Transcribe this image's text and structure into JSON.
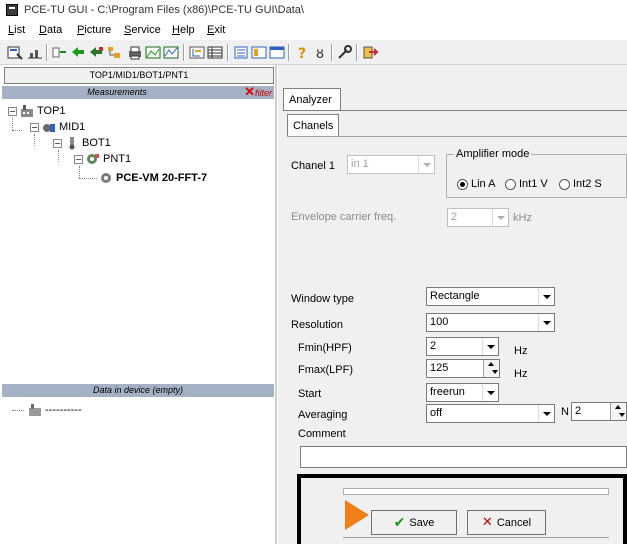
{
  "window": {
    "title": "PCE-TU GUI - C:\\Program Files (x86)\\PCE-TU GUI\\Data\\"
  },
  "menu": [
    {
      "accel": "L",
      "rest": "ist"
    },
    {
      "accel": "D",
      "rest": "ata"
    },
    {
      "accel": "P",
      "rest": "icture"
    },
    {
      "accel": "S",
      "rest": "ervice"
    },
    {
      "accel": "H",
      "rest": "elp"
    },
    {
      "accel": "E",
      "rest": "xit"
    }
  ],
  "left": {
    "path": "TOP1/MID1/BOT1/PNT1",
    "measurements_title": "Measurements",
    "filter_label": "filter",
    "tree": {
      "top": "TOP1",
      "mid": "MID1",
      "bot": "BOT1",
      "pnt": "PNT1",
      "device": "PCE-VM 20-FFT-7"
    },
    "data_title": "Data in device (empty)",
    "data_item": "----------"
  },
  "right": {
    "tab_analyzer": "Analyzer",
    "tab_chanels": "Chanels",
    "chanel_label": "Chanel 1",
    "chanel_value": "in 1",
    "amp_mode_label": "Amplifier mode",
    "amp_options": [
      "Lin A",
      "Int1 V",
      "Int2 S"
    ],
    "envelope_label": "Envelope carrier freq.",
    "envelope_value": "2",
    "envelope_unit": "kHz",
    "window_type_label": "Window type",
    "window_type_value": "Rectangle",
    "resolution_label": "Resolution",
    "resolution_value": "100",
    "fmin_label": "Fmin(HPF)",
    "fmin_value": "2",
    "fmin_unit": "Hz",
    "fmax_label": "Fmax(LPF)",
    "fmax_value": "125",
    "fmax_unit": "Hz",
    "start_label": "Start",
    "start_value": "freerun",
    "averaging_label": "Averaging",
    "averaging_value": "off",
    "n_label": "N",
    "n_value": "2",
    "comment_label": "Comment",
    "comment_value": ""
  },
  "dialog": {
    "save_label": "Save",
    "cancel_label": "Cancel"
  },
  "colors": {
    "header_blue": "#a3b1c4",
    "accent_orange": "#f07f17",
    "filter_red": "#e00000",
    "save_green": "#1a9a1a",
    "cancel_red": "#d00000"
  }
}
